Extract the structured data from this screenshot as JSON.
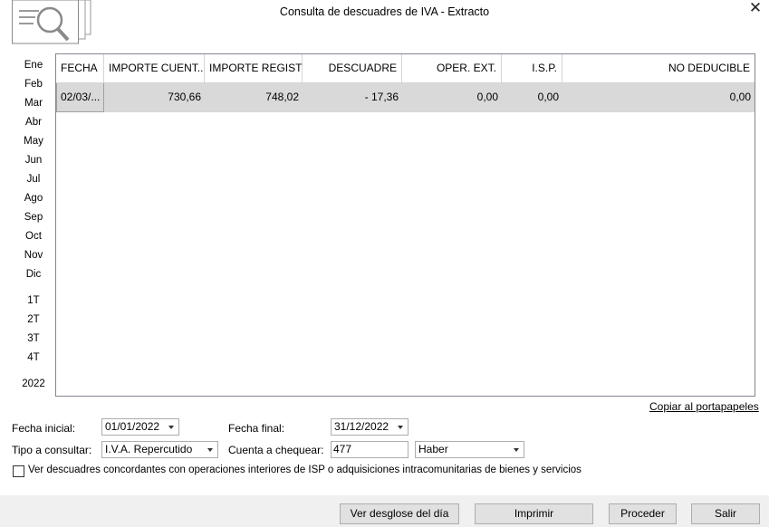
{
  "window": {
    "title": "Consulta de descuadres de IVA - Extracto",
    "close_glyph": "✕"
  },
  "months": [
    "Ene",
    "Feb",
    "Mar",
    "Abr",
    "May",
    "Jun",
    "Jul",
    "Ago",
    "Sep",
    "Oct",
    "Nov",
    "Dic"
  ],
  "quarters": [
    "1T",
    "2T",
    "3T",
    "4T"
  ],
  "year": "2022",
  "table": {
    "columns": [
      "FECHA",
      "IMPORTE CUENT...",
      "IMPORTE REGIST...",
      "DESCUADRE",
      "OPER. EXT.",
      "I.S.P.",
      "NO DEDUCIBLE"
    ],
    "rows": [
      [
        "02/03/...",
        "730,66",
        "748,02",
        "- 17,36",
        "0,00",
        "0,00",
        "0,00"
      ]
    ]
  },
  "copy_link": "Copiar al portapapeles",
  "form": {
    "fecha_inicial_label": "Fecha inicial:",
    "fecha_inicial_value": "01/01/2022",
    "fecha_final_label": "Fecha final:",
    "fecha_final_value": "31/12/2022",
    "tipo_label": "Tipo a consultar:",
    "tipo_value": "I.V.A. Repercutido",
    "cuenta_label": "Cuenta a chequear:",
    "cuenta_value": "477",
    "haber_value": "Haber",
    "checkbox_label": "Ver descuadres concordantes con operaciones interiores de ISP o adquisiciones intracomunitarias de bienes y servicios",
    "checkbox_checked": false
  },
  "buttons": {
    "desglose": "Ver desglose del día",
    "imprimir": "Imprimir",
    "proceder": "Proceder",
    "salir": "Salir"
  },
  "colors": {
    "selected_row": "#d9d9d9",
    "footer_bg": "#f0f0f0",
    "button_bg": "#e1e1e1"
  }
}
